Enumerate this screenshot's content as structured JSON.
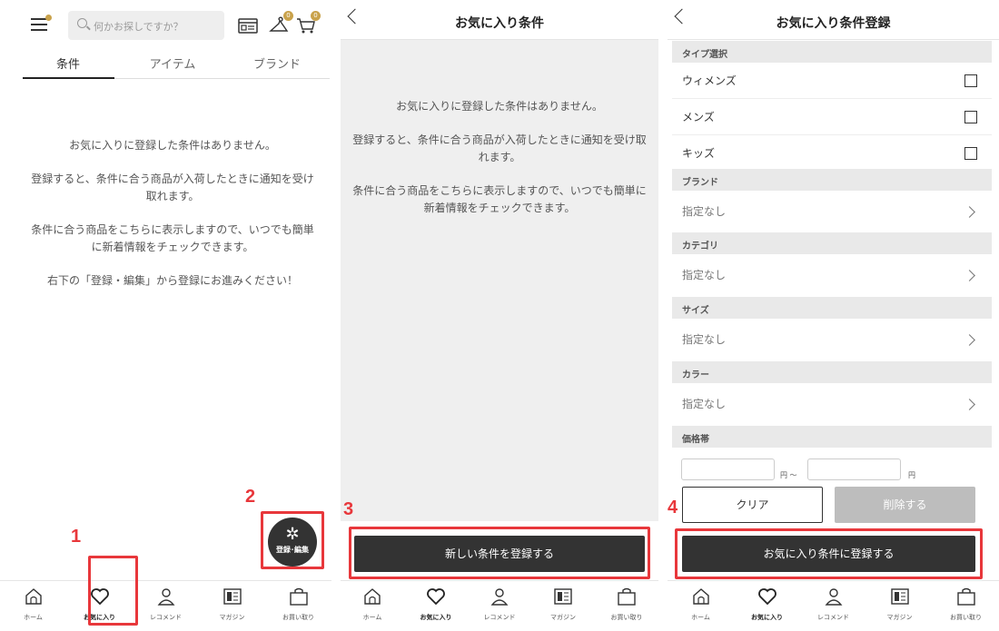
{
  "screen1": {
    "search_placeholder": "何かお探しですか？",
    "badge_a": "0",
    "badge_b": "0",
    "tabs": [
      "条件",
      "アイテム",
      "ブランド"
    ],
    "messages": [
      "お気に入りに登録した条件はありません。",
      "登録すると、条件に合う商品が入荷したときに通知を受け取れます。",
      "条件に合う商品をこちらに表示しますので、いつでも簡単に新着情報をチェックできます。",
      "右下の「登録・編集」から登録にお進みください！"
    ],
    "fab_label": "登録･編集",
    "annotation_1": "1",
    "annotation_2": "2"
  },
  "screen2": {
    "title": "お気に入り条件",
    "messages": [
      "お気に入りに登録した条件はありません。",
      "登録すると、条件に合う商品が入荷したときに通知を受け取れます。",
      "条件に合う商品をこちらに表示しますので、いつでも簡単に新着情報をチェックできます。"
    ],
    "register_button": "新しい条件を登録する",
    "annotation_3": "3"
  },
  "screen3": {
    "title": "お気に入り条件登録",
    "type_section": "タイプ選択",
    "types": [
      "ウィメンズ",
      "メンズ",
      "キッズ"
    ],
    "brand_section": "ブランド",
    "brand_value": "指定なし",
    "category_section": "カテゴリ",
    "category_value": "指定なし",
    "size_section": "サイズ",
    "size_value": "指定なし",
    "color_section": "カラー",
    "color_value": "指定なし",
    "price_section": "価格帯",
    "yen_from": "円 ～",
    "yen_to": "円",
    "clear_button": "クリア",
    "delete_button": "削除する",
    "submit_button": "お気に入り条件に登録する",
    "annotation_4": "4"
  },
  "bottom_nav": [
    "ホーム",
    "お気に入り",
    "レコメンド",
    "マガジン",
    "お買い取り"
  ],
  "colors": {
    "accent_gold": "#c9a24b",
    "annotation_red": "#e8373b",
    "dark_button": "#333333"
  }
}
